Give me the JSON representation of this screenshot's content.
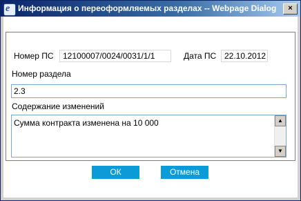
{
  "window": {
    "title": "Информация о переоформляемых разделах -- Webpage Dialog",
    "close_symbol": "×",
    "app_icon": "ie-icon"
  },
  "form": {
    "ps_number_label": "Номер ПС",
    "ps_number_value": "12100007/0024/0031/1/1",
    "ps_date_label": "Дата ПС",
    "ps_date_value": "22.10.2012",
    "section_number_label": "Номер раздела",
    "section_number_value": "2.3",
    "changes_label": "Содержание изменений",
    "changes_value": "Сумма контракта изменена на 10 000"
  },
  "buttons": {
    "ok_label": "ОК",
    "cancel_label": "Отмена"
  },
  "colors": {
    "title_bar": "#0a246a",
    "button_bg": "#0b9bd6",
    "input_border": "#7fa7c9"
  }
}
